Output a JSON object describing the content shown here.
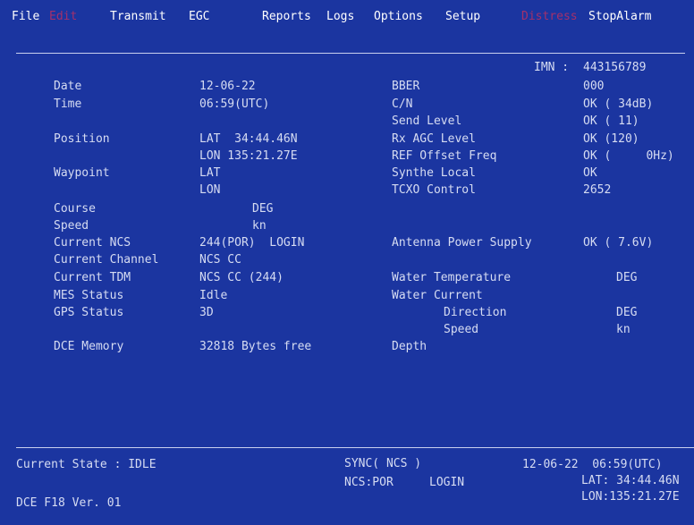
{
  "menu": {
    "file": "File",
    "edit": "Edit",
    "transmit": "Transmit",
    "egc": "EGC",
    "reports": "Reports",
    "logs": "Logs",
    "options": "Options",
    "setup": "Setup",
    "distress": "Distress",
    "stop_alarm": "StopAlarm"
  },
  "imn": {
    "label": "IMN :",
    "value": "443156789"
  },
  "left": {
    "date_label": "Date",
    "date_value": "12-06-22",
    "time_label": "Time",
    "time_value": "06:59(UTC)",
    "position_label": "Position",
    "lat_value": "LAT  34:44.46N",
    "lon_value": "LON 135:21.27E",
    "waypoint_label": "Waypoint",
    "wp_lat": "LAT",
    "wp_lon": "LON",
    "course_label": "Course",
    "course_unit": "DEG",
    "speed_label": "Speed",
    "speed_unit": "kn",
    "ncs_label": "Current NCS",
    "ncs_value": "244(POR)  LOGIN",
    "channel_label": "Current Channel",
    "channel_value": "NCS CC",
    "tdm_label": "Current TDM",
    "tdm_value": "NCS CC (244)",
    "mes_label": "MES Status",
    "mes_value": "Idle",
    "gps_label": "GPS Status",
    "gps_value": "3D",
    "dce_label": "DCE Memory",
    "dce_value": "32818 Bytes free"
  },
  "right": {
    "bber_label": "BBER",
    "bber_value": "000",
    "cn_label": "C/N",
    "cn_value": "OK ( 34dB)",
    "send_label": "Send Level",
    "send_value": "OK ( 11)",
    "agc_label": "Rx AGC Level",
    "agc_value": "OK (120)",
    "ref_label": "REF Offset Freq",
    "ref_value": "OK (     0Hz)",
    "synth_label": "Synthe Local",
    "synth_value": "OK",
    "tcxo_label": "TCXO Control",
    "tcxo_value": "2652",
    "antenna_label": "Antenna Power Supply",
    "antenna_value": "OK ( 7.6V)",
    "water_temp_label": "Water Temperature",
    "water_temp_unit": "DEG",
    "water_current_label": "Water Current",
    "direction_label": "Direction",
    "direction_unit": "DEG",
    "wc_speed_label": "Speed",
    "wc_speed_unit": "kn",
    "depth_label": "Depth"
  },
  "status": {
    "state": "Current State : IDLE",
    "sync": "SYNC( NCS )",
    "ncs": "NCS:POR",
    "login": "LOGIN",
    "datetime": "12-06-22  06:59(UTC)",
    "lat": "LAT: 34:44.46N",
    "lon": "LON:135:21.27E",
    "version": "DCE F18 Ver. 01"
  },
  "colors": {
    "background": "#1b35a0",
    "text": "#d6dcf2",
    "menu_text": "#ffffff",
    "disabled_menu": "#a4306a"
  }
}
